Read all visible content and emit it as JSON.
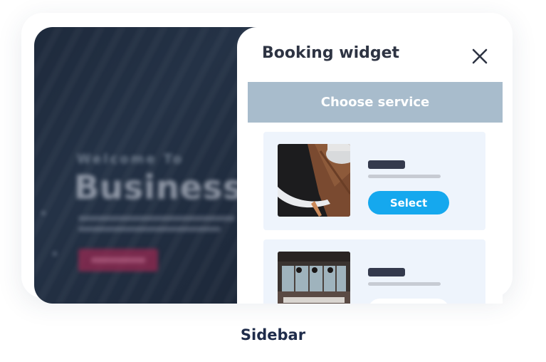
{
  "panel": {
    "title": "Booking widget",
    "choose_service_label": "Choose service"
  },
  "services": [
    {
      "select_label": "Select"
    },
    {
      "select_label": ""
    }
  ],
  "caption": "Sidebar",
  "colors": {
    "choose_bar": "#a8bccc",
    "card_bg": "#eef4fc",
    "select_button": "#15a8ee",
    "caption": "#1f2c4a"
  }
}
